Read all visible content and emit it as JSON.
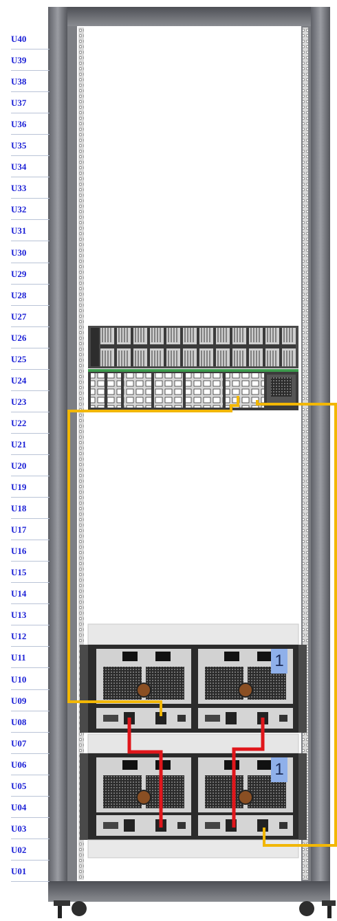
{
  "rack": {
    "units": [
      "U40",
      "U39",
      "U38",
      "U37",
      "U36",
      "U35",
      "U34",
      "U33",
      "U32",
      "U31",
      "U30",
      "U29",
      "U28",
      "U27",
      "U26",
      "U25",
      "U24",
      "U23",
      "U22",
      "U21",
      "U20",
      "U19",
      "U18",
      "U17",
      "U16",
      "U15",
      "U14",
      "U13",
      "U12",
      "U11",
      "U10",
      "U09",
      "U08",
      "U07",
      "U06",
      "U05",
      "U04",
      "U03",
      "U02",
      "U01"
    ]
  },
  "devices": {
    "switch_top": {
      "units": "U26-U25"
    },
    "switch_bottom": {
      "units": "U24-U23"
    },
    "enclosure_upper": {
      "units": "U11-U07",
      "badges": [
        "1"
      ]
    },
    "enclosure_lower": {
      "units": "U06-U02",
      "badges": [
        "1"
      ]
    }
  },
  "cables": {
    "colors": {
      "sas": "#f2b705",
      "power": "#e0161b"
    }
  }
}
